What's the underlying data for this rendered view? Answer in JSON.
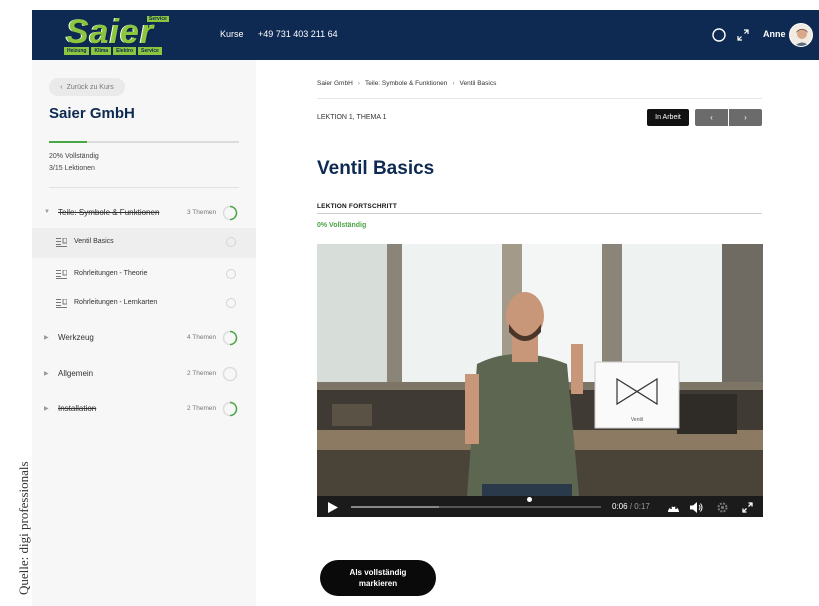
{
  "credit": "Quelle: digi professionals",
  "header": {
    "logo_text": "Saier",
    "logo_service": "Service",
    "logo_tags": [
      "Heizung",
      "Klima",
      "Elektro",
      "Service"
    ],
    "nav_kurse": "Kurse",
    "phone": "+49 731 403 211 64",
    "user_name": "Anne",
    "icons": [
      "theme-toggle-icon",
      "fullscreen-icon"
    ]
  },
  "sidebar": {
    "back_label": "Zurück zu Kurs",
    "company": "Saier GmbH",
    "progress_percent": 20,
    "progress_text": "20% Vollständig",
    "lessons_text": "3/15 Lektionen",
    "sections": [
      {
        "title": "Teile: Symbole & Funktionen",
        "count": "3 Themen",
        "expanded": true,
        "struck": true,
        "lessons": [
          {
            "title": "Ventil Basics",
            "active": true
          },
          {
            "title": "Rohrleitungen - Theorie",
            "active": false
          },
          {
            "title": "Rohrleitungen - Lernkarten",
            "active": false
          }
        ]
      },
      {
        "title": "Werkzeug",
        "count": "4 Themen",
        "expanded": false,
        "struck": false
      },
      {
        "title": "Allgemein",
        "count": "2 Themen",
        "expanded": false,
        "struck": false
      },
      {
        "title": "Installation",
        "count": "2 Themen",
        "expanded": false,
        "struck": true
      }
    ]
  },
  "main": {
    "breadcrumb": [
      "Saier GmbH",
      "Teile: Symbole & Funktionen",
      "Ventil Basics"
    ],
    "lesson_label": "LEKTION 1, THEMA 1",
    "status": "In Arbeit",
    "prev_icon": "‹",
    "next_icon": "›",
    "title": "Ventil Basics",
    "progress_label": "LEKTION FORTSCHRITT",
    "progress_percent_text": "0% Vollständig",
    "video": {
      "current": "0:06",
      "duration": "0:17",
      "sign_text": "Ventil",
      "played_fraction": 0.35
    },
    "complete_button": [
      "Als vollständig",
      "markieren"
    ]
  },
  "colors": {
    "header_bg": "#0e2a52",
    "logo_green": "#8cc63f",
    "progress_green": "#4aa544"
  }
}
